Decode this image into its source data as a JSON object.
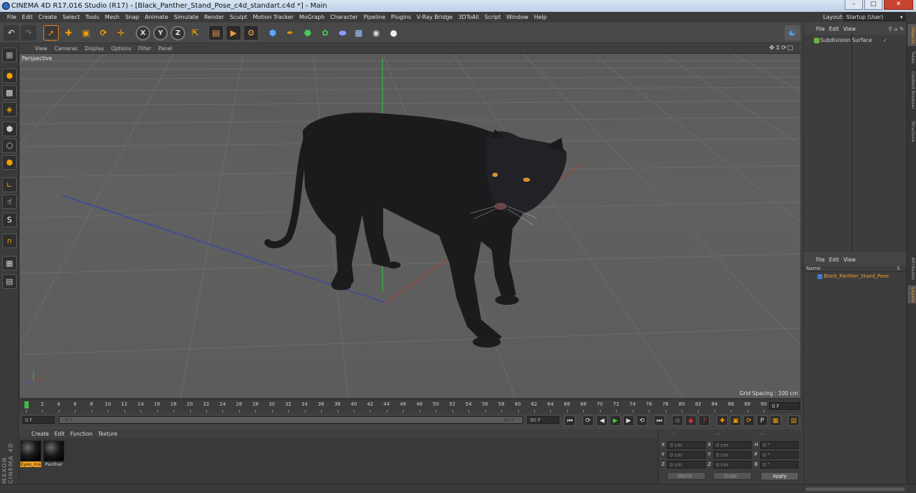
{
  "window": {
    "title": "CINEMA 4D R17.016 Studio (R17) - [Black_Panther_Stand_Pose_c4d_standart.c4d *] - Main",
    "buttons": [
      "minimize-icon",
      "maximize-icon",
      "close-icon"
    ]
  },
  "menubar": {
    "items": [
      "File",
      "Edit",
      "Create",
      "Select",
      "Tools",
      "Mesh",
      "Snap",
      "Animate",
      "Simulate",
      "Render",
      "Sculpt",
      "Motion Tracker",
      "MoGraph",
      "Character",
      "Pipeline",
      "Plugins",
      "V-Ray Bridge",
      "3DToAll",
      "Script",
      "Window",
      "Help"
    ],
    "layout_label": "Layout:",
    "layout_value": "Startup (User)"
  },
  "toolbar": {
    "icons": [
      "undo-icon",
      "redo-icon",
      "select-icon",
      "move-icon",
      "scale-icon",
      "rotate-icon",
      "add-icon",
      "x-axis-icon",
      "y-axis-icon",
      "z-axis-icon",
      "coord-system-icon",
      "render-view-icon",
      "render-picture-viewer-icon",
      "edit-render-settings-icon",
      "cube-icon",
      "pen-icon",
      "subdivision-icon",
      "array-icon",
      "deformer-icon",
      "floor-icon",
      "camera-icon",
      "light-icon"
    ],
    "axis_labels": [
      "X",
      "Y",
      "Z"
    ]
  },
  "viewport": {
    "menu": [
      "View",
      "Cameras",
      "Display",
      "Options",
      "Filter",
      "Panel"
    ],
    "label": "Perspective",
    "grid_spacing": "Grid Spacing : 100 cm",
    "colors": {
      "x_axis": "#c0392b",
      "y_axis": "#2ecc40",
      "z_axis": "#2040c0"
    }
  },
  "timeline": {
    "ticks": [
      "0",
      "2",
      "4",
      "6",
      "8",
      "10",
      "12",
      "14",
      "16",
      "18",
      "20",
      "22",
      "24",
      "26",
      "28",
      "30",
      "32",
      "34",
      "36",
      "38",
      "40",
      "42",
      "44",
      "46",
      "48",
      "50",
      "52",
      "54",
      "56",
      "58",
      "60",
      "62",
      "64",
      "66",
      "68",
      "70",
      "72",
      "74",
      "76",
      "78",
      "80",
      "82",
      "84",
      "86",
      "88",
      "90"
    ],
    "current_frame": "0 F",
    "start_field": "0 F",
    "range_start": "0 F",
    "range_end": "90 F",
    "end_field": "90 F"
  },
  "materials": {
    "menu": [
      "Create",
      "Edit",
      "Function",
      "Texture"
    ],
    "items": [
      {
        "name": "Eyes_ma",
        "selected": true
      },
      {
        "name": "Panther",
        "selected": false
      }
    ]
  },
  "coordinates": {
    "header": [
      "--",
      "--",
      "--"
    ],
    "rows": [
      {
        "a_label": "X",
        "a_value": "0 cm",
        "b_label": "X",
        "b_value": "0 cm",
        "c_label": "H",
        "c_value": "0 °"
      },
      {
        "a_label": "Y",
        "a_value": "0 cm",
        "b_label": "Y",
        "b_value": "0 cm",
        "c_label": "P",
        "c_value": "0 °"
      },
      {
        "a_label": "Z",
        "a_value": "0 cm",
        "b_label": "Z",
        "b_value": "0 cm",
        "c_label": "B",
        "c_value": "0 °"
      }
    ],
    "world_select": "World",
    "scale_select": "Scale",
    "apply_label": "Apply"
  },
  "object_manager": {
    "menu": [
      "File",
      "Edit",
      "View"
    ],
    "items": [
      {
        "name": "Subdivision Surface"
      }
    ]
  },
  "layer_manager": {
    "menu": [
      "File",
      "Edit",
      "View"
    ],
    "col_name": "Name",
    "col_s": "S",
    "items": [
      {
        "name": "Black_Panther_Stand_Pose"
      }
    ]
  },
  "right_tabs": [
    "Objects",
    "Takes",
    "Content Browser",
    "Structure",
    "Attributes",
    "Layers"
  ],
  "brand": "MAXON CINEMA 4D"
}
